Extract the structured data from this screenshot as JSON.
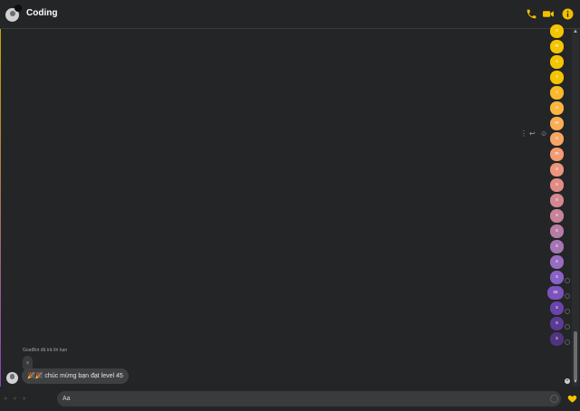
{
  "header": {
    "title": "Coding",
    "icons": [
      "phone-icon",
      "video-camera-icon",
      "info-icon"
    ],
    "accent_color": "#f0c000"
  },
  "messages_outgoing": [
    {
      "text": "s",
      "color": "#f5c400"
    },
    {
      "text": "m",
      "color": "#f5c400"
    },
    {
      "text": "s",
      "color": "#f5c400"
    },
    {
      "text": "s",
      "color": "#f5c400"
    },
    {
      "text": "s",
      "color": "#fbb82a"
    },
    {
      "text": "s",
      "color": "#fbb540"
    },
    {
      "text": "m",
      "color": "#f9ad55"
    },
    {
      "text": "s",
      "color": "#f7a566"
    },
    {
      "text": "m",
      "color": "#f29c73"
    },
    {
      "text": "s",
      "color": "#ec957e"
    },
    {
      "text": "s",
      "color": "#e08c86"
    },
    {
      "text": "s",
      "color": "#d3878f"
    },
    {
      "text": "s",
      "color": "#c6839a"
    },
    {
      "text": "s",
      "color": "#b77ca6"
    },
    {
      "text": "s",
      "color": "#a675b4"
    },
    {
      "text": "s",
      "color": "#976cc1"
    },
    {
      "text": "s",
      "color": "#8a61c6"
    },
    {
      "text": "ss",
      "color": "#7c53bd"
    },
    {
      "text": "s",
      "color": "#6a44a9"
    },
    {
      "text": "s",
      "color": "#5b3b93"
    },
    {
      "text": "s",
      "color": "#4f3580"
    }
  ],
  "reply": {
    "note": "GoatBot đã trả lời bạn",
    "quoted": "s",
    "message": "🎉🎉 chúc mừng bạn đạt level 45"
  },
  "composer": {
    "placeholder": "Aa",
    "send_icon": "heart-icon"
  }
}
